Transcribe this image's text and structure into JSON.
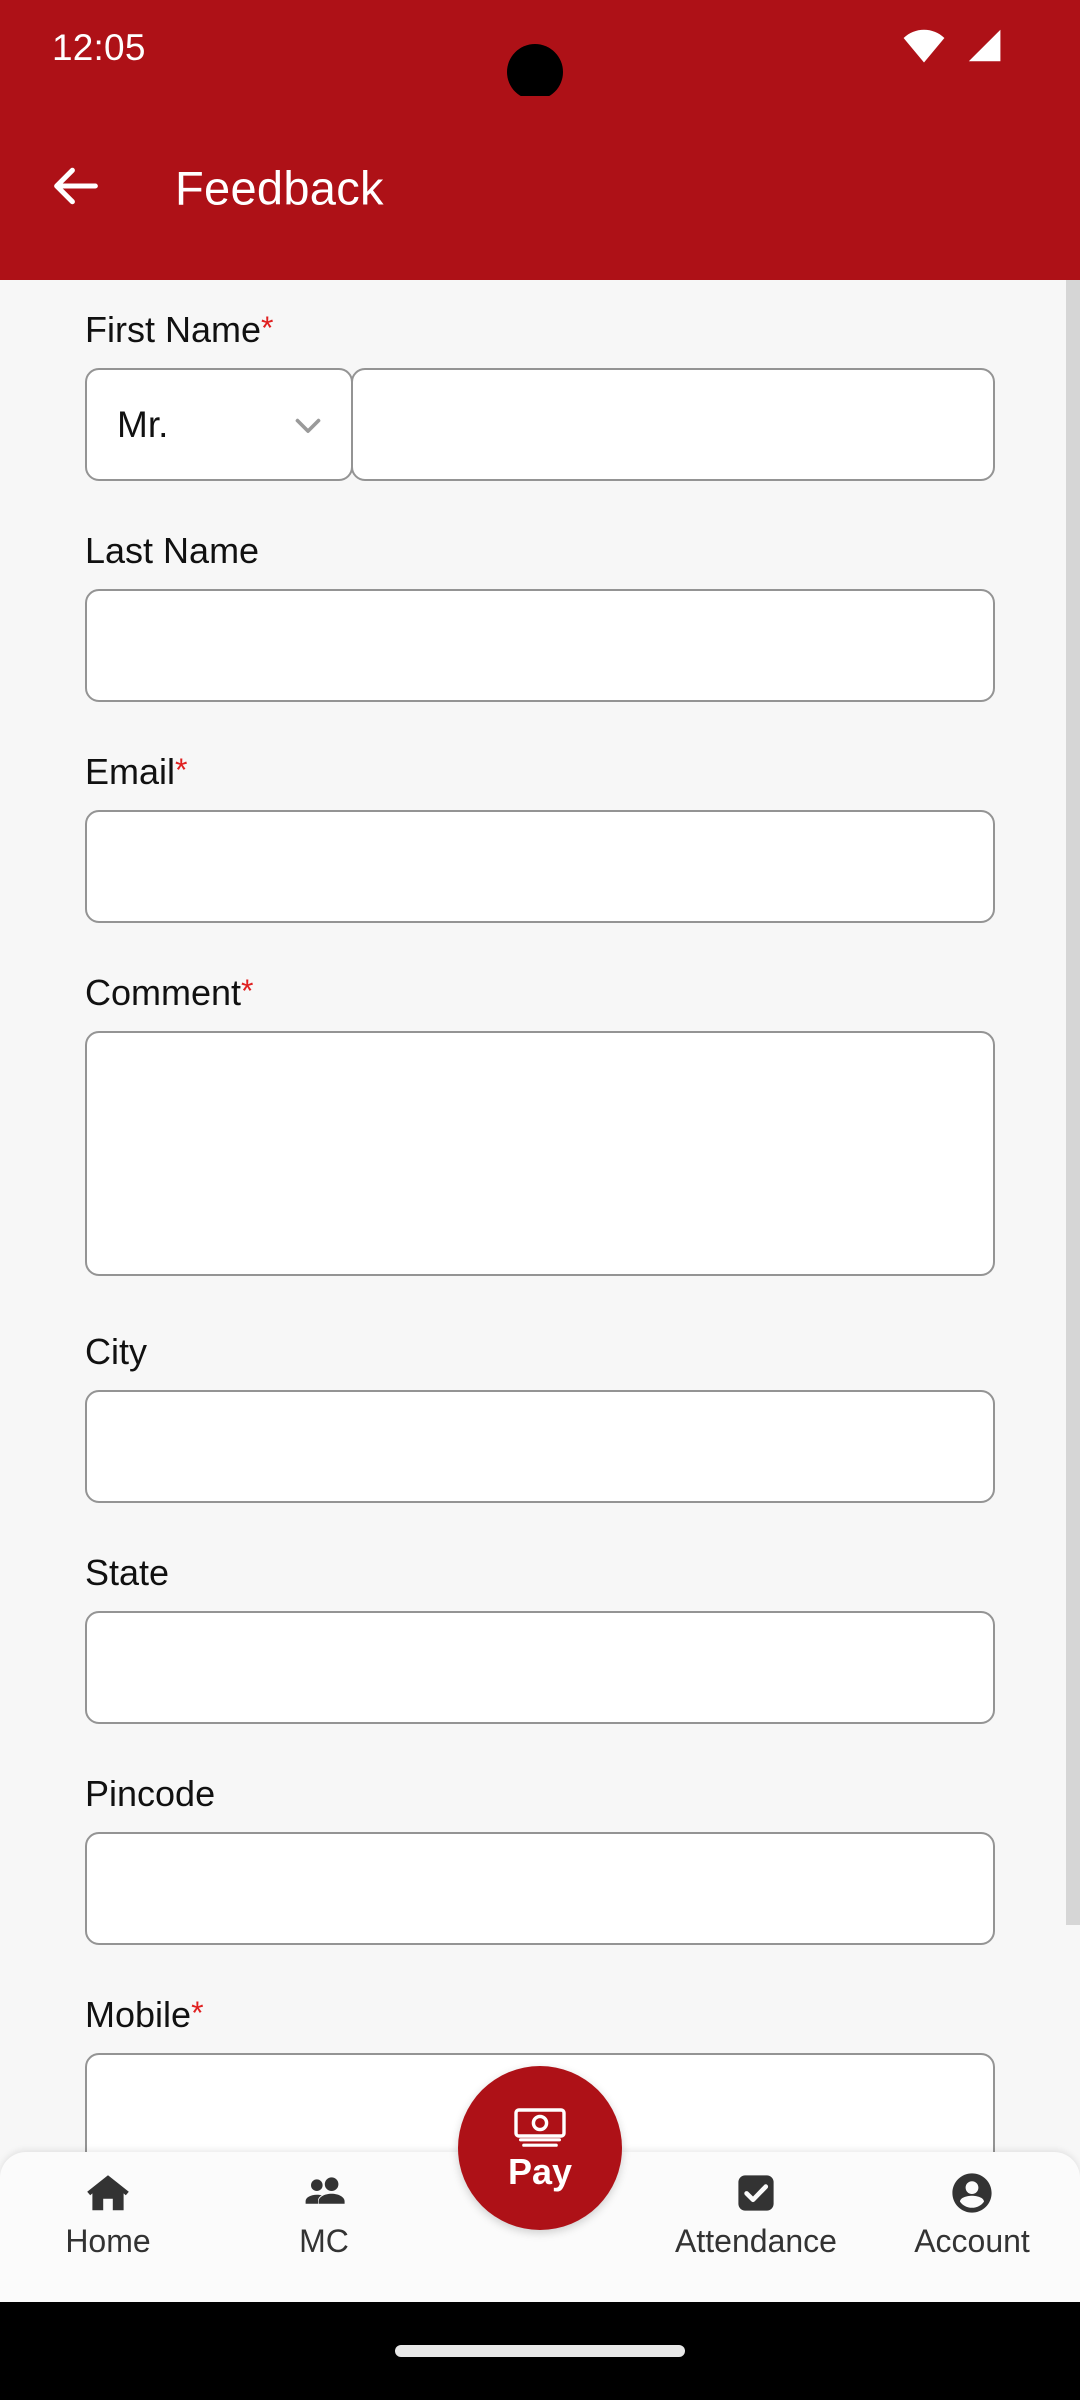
{
  "theme": {
    "primary": "#ae1117",
    "required_asterisk": "#e02020",
    "page_background": "#f7f7f7",
    "field_border": "#949494",
    "nav_icon": "#333333",
    "scrollbar": "#d6d6d6"
  },
  "status_bar": {
    "time": "12:05",
    "icons": [
      "wifi-icon",
      "cellular-signal-icon"
    ]
  },
  "app_bar": {
    "back_icon": "arrow-left-icon",
    "title": "Feedback"
  },
  "form": {
    "required_marker": "*",
    "fields": [
      {
        "key": "first_name",
        "label": "First Name",
        "required": true,
        "type": "salutation_plus_text",
        "salutation": {
          "value": "Mr.",
          "icon": "chevron-down-icon"
        },
        "value": ""
      },
      {
        "key": "last_name",
        "label": "Last Name",
        "required": false,
        "type": "text",
        "value": ""
      },
      {
        "key": "email",
        "label": "Email",
        "required": true,
        "type": "text",
        "value": ""
      },
      {
        "key": "comment",
        "label": "Comment",
        "required": true,
        "type": "textarea",
        "value": ""
      },
      {
        "key": "city",
        "label": "City",
        "required": false,
        "type": "text",
        "value": ""
      },
      {
        "key": "state",
        "label": "State",
        "required": false,
        "type": "text",
        "value": ""
      },
      {
        "key": "pincode",
        "label": "Pincode",
        "required": false,
        "type": "text",
        "value": ""
      },
      {
        "key": "mobile",
        "label": "Mobile",
        "required": true,
        "type": "text",
        "value": ""
      }
    ]
  },
  "bottom_nav": {
    "items": [
      {
        "label": "Home",
        "icon": "home-icon"
      },
      {
        "label": "MC",
        "icon": "people-group-icon"
      },
      {
        "label": "Attendance",
        "icon": "checkbox-checked-icon"
      },
      {
        "label": "Account",
        "icon": "account-circle-icon"
      }
    ],
    "fab": {
      "label": "Pay",
      "icon": "banknote-icon"
    }
  },
  "system_nav": {
    "indicator": "home-indicator-pill"
  }
}
